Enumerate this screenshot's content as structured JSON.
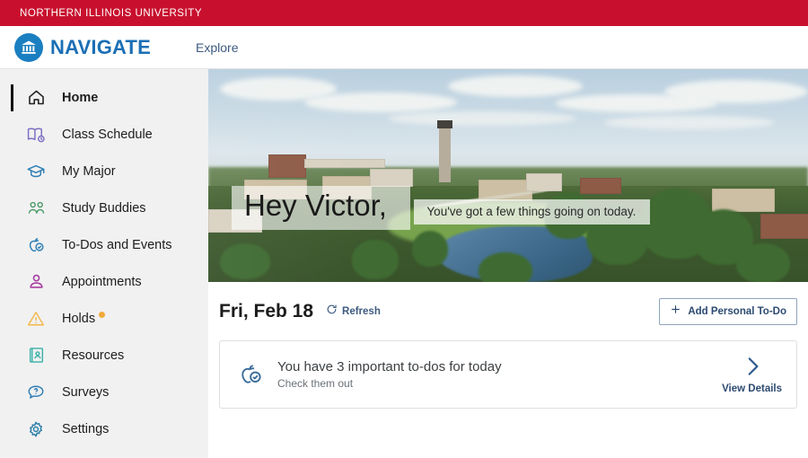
{
  "university_bar": {
    "name": "NORTHERN ILLINOIS UNIVERSITY",
    "color": "#c8102e"
  },
  "header": {
    "brand_name": "NAVIGATE",
    "brand_icon": "bank-building-icon",
    "brand_color": "#1b6fb5",
    "nav_link": "Explore"
  },
  "sidebar": {
    "items": [
      {
        "label": "Home",
        "icon": "home-icon",
        "color": "#222222",
        "active": true,
        "badge": false
      },
      {
        "label": "Class Schedule",
        "icon": "open-book-clock-icon",
        "color": "#7b6fc4",
        "active": false,
        "badge": false
      },
      {
        "label": "My Major",
        "icon": "graduation-cap-icon",
        "color": "#2f7fb5",
        "active": false,
        "badge": false
      },
      {
        "label": "Study Buddies",
        "icon": "two-people-icon",
        "color": "#4c9a6a",
        "active": false,
        "badge": false
      },
      {
        "label": "To-Dos and Events",
        "icon": "apple-check-icon",
        "color": "#2f7fb5",
        "active": false,
        "badge": false
      },
      {
        "label": "Appointments",
        "icon": "person-icon",
        "color": "#a93fa0",
        "active": false,
        "badge": false
      },
      {
        "label": "Holds",
        "icon": "warning-triangle-icon",
        "color": "#f2b84b",
        "active": false,
        "badge": true
      },
      {
        "label": "Resources",
        "icon": "id-card-icon",
        "color": "#38b1a8",
        "active": false,
        "badge": false
      },
      {
        "label": "Surveys",
        "icon": "speech-bubble-question-icon",
        "color": "#2f7fb5",
        "active": false,
        "badge": false
      },
      {
        "label": "Settings",
        "icon": "gear-icon",
        "color": "#2b7fa8",
        "active": false,
        "badge": false
      }
    ],
    "badge_color": "#f2a93b"
  },
  "hero": {
    "greeting": "Hey Victor,",
    "subtitle": "You've got a few things going on today.",
    "image_alt": "aerial-campus-photo"
  },
  "today": {
    "date_label": "Fri, Feb 18",
    "refresh_label": "Refresh",
    "refresh_icon": "refresh-icon",
    "add_todo_label": "Add Personal To-Do",
    "add_todo_icon": "plus-icon"
  },
  "todo_card": {
    "icon": "apple-check-icon",
    "title": "You have 3 important to-dos for today",
    "subtitle": "Check them out",
    "action_label": "View Details",
    "action_icon": "chevron-right-icon"
  }
}
